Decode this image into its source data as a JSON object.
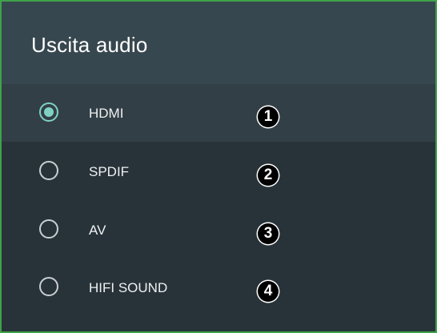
{
  "dialog": {
    "title": "Uscita audio",
    "selected_index": 0,
    "options": [
      {
        "label": "HDMI",
        "badge": "1",
        "selected": true
      },
      {
        "label": "SPDIF",
        "badge": "2",
        "selected": false
      },
      {
        "label": "AV",
        "badge": "3",
        "selected": false
      },
      {
        "label": "HIFI SOUND",
        "badge": "4",
        "selected": false
      }
    ]
  },
  "colors": {
    "header_bg": "#37474f",
    "list_bg": "#283339",
    "selected_row_bg": "#333f46",
    "radio_accent": "#7fd1c4",
    "frame_border": "#3fa24a"
  }
}
